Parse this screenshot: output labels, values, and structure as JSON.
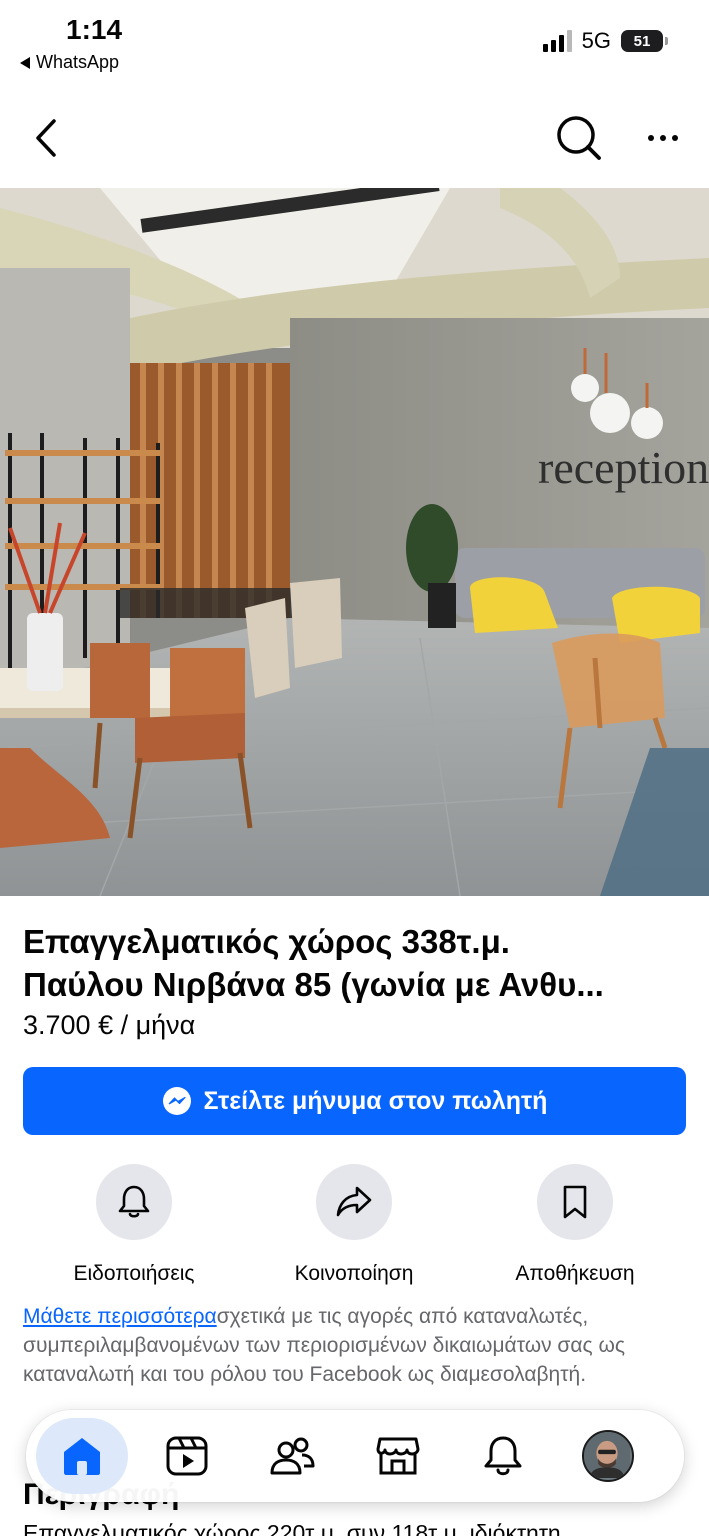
{
  "status_bar": {
    "time": "1:14",
    "back_app": "WhatsApp",
    "network": "5G",
    "battery": "51"
  },
  "listing": {
    "title_line1": "Επαγγελματικός χώρος 338τ.μ.",
    "title_line2": "Παύλου Νιρβάνα 85 (γωνία με Ανθυ...",
    "price": "3.700 € / μήνα",
    "message_button": "Στείλτε μήνυμα στον πωλητή",
    "photo_sign_text": "reception"
  },
  "actions": [
    {
      "label": "Ειδοποιήσεις",
      "icon": "bell-icon"
    },
    {
      "label": "Κοινοποίηση",
      "icon": "share-icon"
    },
    {
      "label": "Αποθήκευση",
      "icon": "bookmark-icon"
    }
  ],
  "info": {
    "link_text": "Μάθετε περισσότερα",
    "text": "σχετικά με τις αγορές από καταναλωτές, συμπεριλαμβανομένων των περιορισμένων δικαιωμάτων σας ως καταναλωτή και του ρόλου του Facebook ως διαμεσολαβητή."
  },
  "description": {
    "heading": "Περιγραφή",
    "text": "Επαγγελματικός χώρος 220τ.μ. συν 118τ.μ. ιδιόκτητη"
  },
  "tabbar": {
    "tabs": [
      "home-icon",
      "video-icon",
      "friends-icon",
      "marketplace-icon",
      "notifications-icon",
      "profile-avatar"
    ],
    "active": "home-icon"
  },
  "colors": {
    "accent": "#0866ff",
    "secondary_text": "#65676b",
    "action_circle": "#e4e6eb"
  }
}
